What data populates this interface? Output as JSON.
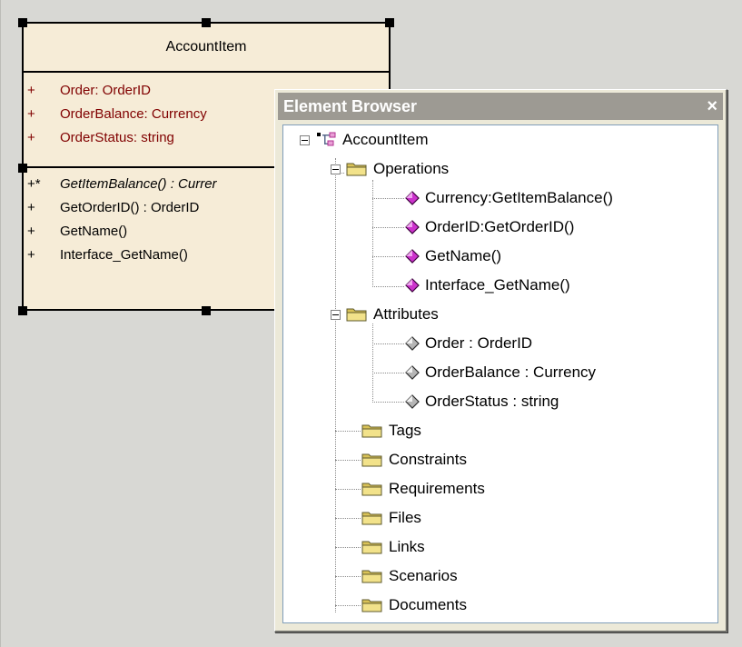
{
  "uml_class": {
    "name": "AccountItem",
    "attributes": [
      {
        "visibility": "+",
        "text": "Order:  OrderID"
      },
      {
        "visibility": "+",
        "text": "OrderBalance:  Currency"
      },
      {
        "visibility": "+",
        "text": "OrderStatus:  string"
      }
    ],
    "operations": [
      {
        "visibility": "+*",
        "text": "GetItemBalance() : Currer",
        "abstract": true
      },
      {
        "visibility": "+",
        "text": "GetOrderID() : OrderID",
        "abstract": false
      },
      {
        "visibility": "+",
        "text": "GetName()",
        "abstract": false
      },
      {
        "visibility": "+",
        "text": "Interface_GetName()",
        "abstract": false
      }
    ]
  },
  "element_browser": {
    "title": "Element Browser",
    "close_glyph": "×",
    "root": "AccountItem",
    "operations_folder": "Operations",
    "operations": [
      "Currency:GetItemBalance()",
      "OrderID:GetOrderID()",
      "GetName()",
      "Interface_GetName()"
    ],
    "attributes_folder": "Attributes",
    "attributes": [
      "Order : OrderID",
      "OrderBalance : Currency",
      "OrderStatus : string"
    ],
    "folders": [
      "Tags",
      "Constraints",
      "Requirements",
      "Files",
      "Links",
      "Scenarios",
      "Documents"
    ]
  },
  "colors": {
    "class_fill": "#f6ecd7",
    "attribute_text": "#800000",
    "operation_icon": "#cc33cc",
    "title_bar": "#9d9a93"
  },
  "icons": {
    "operation": "magenta-gem-icon",
    "attribute": "gray-gem-icon",
    "folder": "folder-icon",
    "class": "class-icon"
  }
}
